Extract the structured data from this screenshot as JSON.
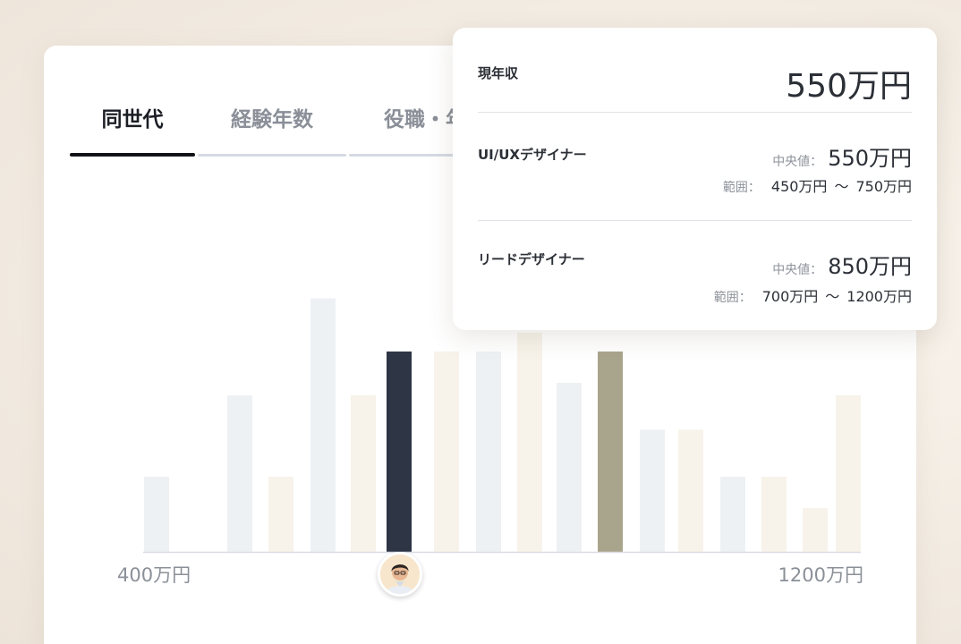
{
  "tabs": [
    {
      "label": "同世代",
      "active": true
    },
    {
      "label": "経験年数",
      "active": false
    },
    {
      "label": "役職・年",
      "active": false
    }
  ],
  "chart_data": {
    "type": "bar",
    "x_min_label": "400万円",
    "x_max_label": "1200万円",
    "bars": [
      {
        "value": 24,
        "color": "#eef1f4"
      },
      {
        "value": 50,
        "color": "#eef1f4"
      },
      {
        "value": 24,
        "color": "#f7f3ea"
      },
      {
        "value": 81,
        "color": "#eef1f4"
      },
      {
        "value": 50,
        "color": "#f7f3ea"
      },
      {
        "value": 64,
        "color": "#2e3545"
      },
      {
        "value": 64,
        "color": "#f7f3ea"
      },
      {
        "value": 64,
        "color": "#eef1f4"
      },
      {
        "value": 70,
        "color": "#f7f3ea"
      },
      {
        "value": 54,
        "color": "#eef1f4"
      },
      {
        "value": 64,
        "color": "#a9a48c"
      },
      {
        "value": 39,
        "color": "#eef1f4"
      },
      {
        "value": 39,
        "color": "#f7f3ea"
      },
      {
        "value": 24,
        "color": "#eef1f4"
      },
      {
        "value": 24,
        "color": "#f7f3ea"
      },
      {
        "value": 14,
        "color": "#f7f3ea"
      },
      {
        "value": 50,
        "color": "#f7f3ea"
      }
    ],
    "highlight_index": 5,
    "compare_index": 10
  },
  "popup": {
    "current": {
      "label": "現年収",
      "value": "550万円"
    },
    "roles": [
      {
        "name": "UI/UXデザイナー",
        "median_label": "中央値：",
        "median": "550万円",
        "range_label": "範囲：",
        "range_min": "450万円",
        "range_sep": "〜",
        "range_max": "750万円"
      },
      {
        "name": "リードデザイナー",
        "median_label": "中央値：",
        "median": "850万円",
        "range_label": "範囲：",
        "range_min": "700万円",
        "range_sep": "〜",
        "range_max": "1200万円"
      }
    ]
  }
}
